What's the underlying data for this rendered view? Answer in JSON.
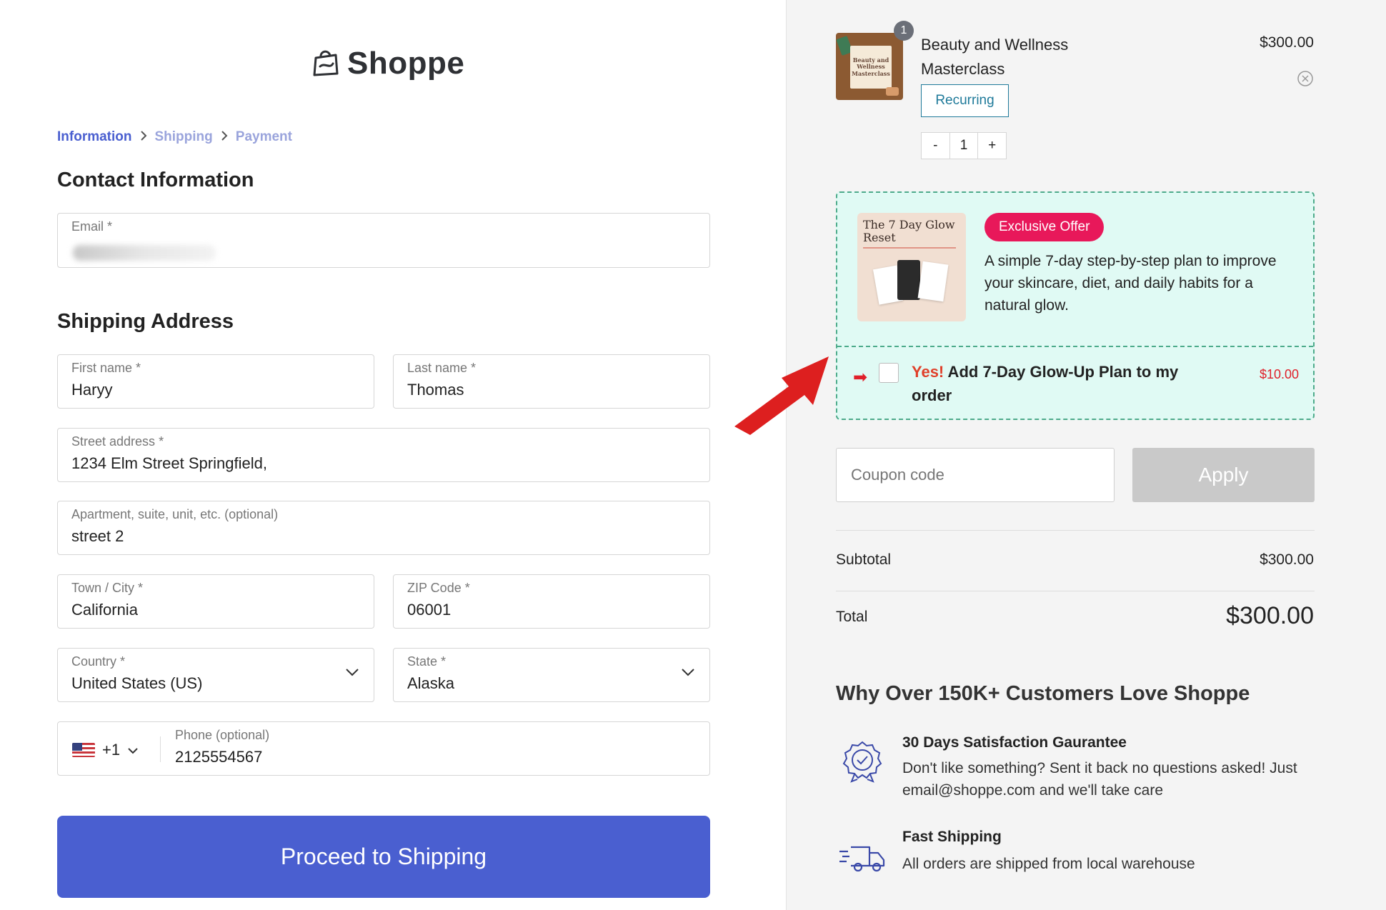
{
  "brand": {
    "name": "Shoppe"
  },
  "breadcrumb": [
    {
      "label": "Information",
      "state": "active"
    },
    {
      "label": "Shipping",
      "state": "inactive"
    },
    {
      "label": "Payment",
      "state": "inactive"
    }
  ],
  "contact": {
    "title": "Contact Information",
    "email_label": "Email *"
  },
  "shipping": {
    "title": "Shipping Address",
    "first_name": {
      "label": "First name *",
      "value": "Haryy"
    },
    "last_name": {
      "label": "Last name *",
      "value": "Thomas"
    },
    "street": {
      "label": "Street address *",
      "value": "1234 Elm Street Springfield,"
    },
    "apartment": {
      "label": "Apartment, suite, unit, etc. (optional)",
      "value": "street 2"
    },
    "city": {
      "label": "Town / City *",
      "value": "California"
    },
    "zip": {
      "label": "ZIP Code *",
      "value": "06001"
    },
    "country": {
      "label": "Country *",
      "value": "United States (US)"
    },
    "state": {
      "label": "State *",
      "value": "Alaska"
    },
    "phone": {
      "label": "Phone (optional)",
      "value": "2125554567",
      "code": "+1"
    }
  },
  "proceed_label": "Proceed to Shipping",
  "cart": {
    "product": {
      "name": "Beauty and Wellness Masterclass",
      "thumb_text": "Beauty and Wellness Masterclass",
      "price": "$300.00",
      "qty_badge": "1",
      "recurring_label": "Recurring",
      "qty_minus": "-",
      "qty_value": "1",
      "qty_plus": "+"
    },
    "offer": {
      "badge": "Exclusive Offer",
      "image_title": "The 7 Day Glow Reset",
      "description": "A simple 7-day step-by-step plan to improve your skincare, diet, and daily habits for a natural glow.",
      "cta_yes": "Yes!",
      "cta_text": " Add 7-Day Glow-Up Plan to my order",
      "price": "$10.00",
      "arrow": "➡"
    },
    "coupon_placeholder": "Coupon code",
    "apply_label": "Apply",
    "subtotal_label": "Subtotal",
    "subtotal_value": "$300.00",
    "total_label": "Total",
    "total_value": "$300.00"
  },
  "why": {
    "title": "Why Over 150K+ Customers Love Shoppe",
    "features": [
      {
        "title": "30 Days Satisfaction Gaurantee",
        "desc": "Don't like something? Sent it back no questions asked! Just email@shoppe.com and we'll take care",
        "icon": "badge-check-icon"
      },
      {
        "title": "Fast Shipping",
        "desc": "All orders are shipped from local warehouse",
        "icon": "delivery-truck-icon"
      }
    ]
  },
  "colors": {
    "accent": "#4a5fd0",
    "offer_bg": "#e0faf4",
    "offer_border": "#4dab8b",
    "badge": "#e8185a",
    "arrow": "#e0202a"
  }
}
